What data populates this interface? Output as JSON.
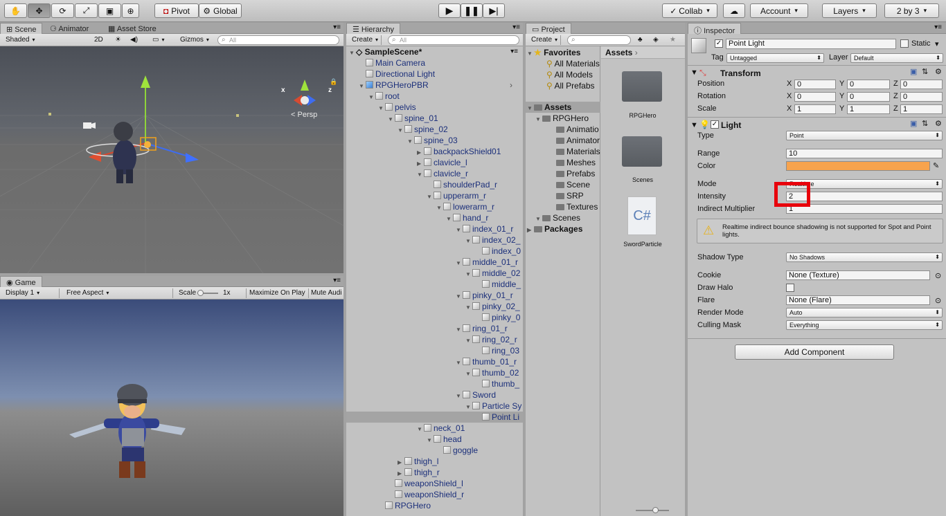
{
  "toolbar": {
    "pivot": "Pivot",
    "global": "Global",
    "collab": "Collab",
    "account": "Account",
    "layers": "Layers",
    "layout": "2 by 3"
  },
  "scene": {
    "tabs": [
      "Scene",
      "Animator",
      "Asset Store"
    ],
    "shading": "Shaded",
    "mode_2d": "2D",
    "gizmos": "Gizmos",
    "search_placeholder": "All",
    "persp": "Persp",
    "axis_x": "x",
    "axis_z": "z"
  },
  "game": {
    "tab": "Game",
    "display": "Display 1",
    "aspect": "Free Aspect",
    "scale_label": "Scale",
    "scale_value": "1x",
    "maximize": "Maximize On Play",
    "mute": "Mute Audi"
  },
  "hierarchy": {
    "tab": "Hierarchy",
    "create": "Create",
    "search_placeholder": "All",
    "scene_name": "SampleScene*",
    "rows": [
      {
        "label": "Main Camera",
        "indent": 0,
        "arrow": ""
      },
      {
        "label": "Directional Light",
        "indent": 0,
        "arrow": ""
      },
      {
        "label": "RPGHeroPBR",
        "indent": 0,
        "arrow": "▼"
      },
      {
        "label": "root",
        "indent": 1,
        "arrow": "▼"
      },
      {
        "label": "pelvis",
        "indent": 2,
        "arrow": "▼"
      },
      {
        "label": "spine_01",
        "indent": 3,
        "arrow": "▼"
      },
      {
        "label": "spine_02",
        "indent": 4,
        "arrow": "▼"
      },
      {
        "label": "spine_03",
        "indent": 5,
        "arrow": "▼"
      },
      {
        "label": "backpackShield01",
        "indent": 6,
        "arrow": "▶"
      },
      {
        "label": "clavicle_l",
        "indent": 6,
        "arrow": "▶"
      },
      {
        "label": "clavicle_r",
        "indent": 6,
        "arrow": "▼"
      },
      {
        "label": "shoulderPad_r",
        "indent": 7,
        "arrow": ""
      },
      {
        "label": "upperarm_r",
        "indent": 7,
        "arrow": "▼"
      },
      {
        "label": "lowerarm_r",
        "indent": 8,
        "arrow": "▼"
      },
      {
        "label": "hand_r",
        "indent": 9,
        "arrow": "▼"
      },
      {
        "label": "index_01_r",
        "indent": 10,
        "arrow": "▼"
      },
      {
        "label": "index_02_",
        "indent": 11,
        "arrow": "▼"
      },
      {
        "label": "index_0",
        "indent": 12,
        "arrow": ""
      },
      {
        "label": "middle_01_r",
        "indent": 10,
        "arrow": "▼"
      },
      {
        "label": "middle_02",
        "indent": 11,
        "arrow": "▼"
      },
      {
        "label": "middle_",
        "indent": 12,
        "arrow": ""
      },
      {
        "label": "pinky_01_r",
        "indent": 10,
        "arrow": "▼"
      },
      {
        "label": "pinky_02_",
        "indent": 11,
        "arrow": "▼"
      },
      {
        "label": "pinky_0",
        "indent": 12,
        "arrow": ""
      },
      {
        "label": "ring_01_r",
        "indent": 10,
        "arrow": "▼"
      },
      {
        "label": "ring_02_r",
        "indent": 11,
        "arrow": "▼"
      },
      {
        "label": "ring_03",
        "indent": 12,
        "arrow": ""
      },
      {
        "label": "thumb_01_r",
        "indent": 10,
        "arrow": "▼"
      },
      {
        "label": "thumb_02",
        "indent": 11,
        "arrow": "▼"
      },
      {
        "label": "thumb_",
        "indent": 12,
        "arrow": ""
      },
      {
        "label": "Sword",
        "indent": 10,
        "arrow": "▼"
      },
      {
        "label": "Particle Sy",
        "indent": 11,
        "arrow": "▼"
      },
      {
        "label": "Point Li",
        "indent": 12,
        "arrow": "",
        "selected": true
      },
      {
        "label": "neck_01",
        "indent": 6,
        "arrow": "▼"
      },
      {
        "label": "head",
        "indent": 7,
        "arrow": "▼"
      },
      {
        "label": "goggle",
        "indent": 8,
        "arrow": ""
      },
      {
        "label": "thigh_l",
        "indent": 4,
        "arrow": "▶"
      },
      {
        "label": "thigh_r",
        "indent": 4,
        "arrow": "▶"
      },
      {
        "label": "weaponShield_l",
        "indent": 3,
        "arrow": ""
      },
      {
        "label": "weaponShield_r",
        "indent": 3,
        "arrow": ""
      },
      {
        "label": "RPGHero",
        "indent": 2,
        "arrow": ""
      }
    ]
  },
  "project": {
    "tab": "Project",
    "create": "Create",
    "favorites": "Favorites",
    "fav_items": [
      "All Materials",
      "All Models",
      "All Prefabs"
    ],
    "assets_root": "Assets",
    "tree": [
      {
        "label": "RPGHero",
        "indent": 1
      },
      {
        "label": "Animatio",
        "indent": 2
      },
      {
        "label": "Animator",
        "indent": 2
      },
      {
        "label": "Materials",
        "indent": 2
      },
      {
        "label": "Meshes",
        "indent": 2
      },
      {
        "label": "Prefabs",
        "indent": 2
      },
      {
        "label": "Scene",
        "indent": 2
      },
      {
        "label": "SRP",
        "indent": 2
      },
      {
        "label": "Textures",
        "indent": 2
      },
      {
        "label": "Scenes",
        "indent": 1
      }
    ],
    "packages": "Packages",
    "breadcrumb": "Assets",
    "grid_items": [
      "RPGHero",
      "Scenes",
      "SwordParticle"
    ],
    "cs_glyph": "C#"
  },
  "inspector": {
    "tab": "Inspector",
    "object_name": "Point Light",
    "static_label": "Static",
    "tag_label": "Tag",
    "tag_value": "Untagged",
    "layer_label": "Layer",
    "layer_value": "Default",
    "transform": {
      "title": "Transform",
      "position_label": "Position",
      "rotation_label": "Rotation",
      "scale_label": "Scale",
      "axis_x": "X",
      "axis_y": "Y",
      "axis_z": "Z",
      "position": [
        "0",
        "0",
        "0"
      ],
      "rotation": [
        "0",
        "0",
        "0"
      ],
      "scale": [
        "1",
        "1",
        "1"
      ]
    },
    "light": {
      "title": "Light",
      "type_label": "Type",
      "type_value": "Point",
      "range_label": "Range",
      "range_value": "10",
      "color_label": "Color",
      "color_value": "#f7a34d",
      "mode_label": "Mode",
      "mode_value": "Realtime",
      "intensity_label": "Intensity",
      "intensity_value": "2",
      "indirect_label": "Indirect Multiplier",
      "indirect_value": "1",
      "warning": "Realtime indirect bounce shadowing is not supported for Spot and Point lights.",
      "shadow_label": "Shadow Type",
      "shadow_value": "No Shadows",
      "cookie_label": "Cookie",
      "cookie_value": "None (Texture)",
      "halo_label": "Draw Halo",
      "flare_label": "Flare",
      "flare_value": "None (Flare)",
      "render_label": "Render Mode",
      "render_value": "Auto",
      "culling_label": "Culling Mask",
      "culling_value": "Everything"
    },
    "add_component": "Add Component"
  },
  "colors": {
    "highlight_box": "#e8000b",
    "light_color": "#f7a34d",
    "tree_text": "#1b2f7a"
  }
}
